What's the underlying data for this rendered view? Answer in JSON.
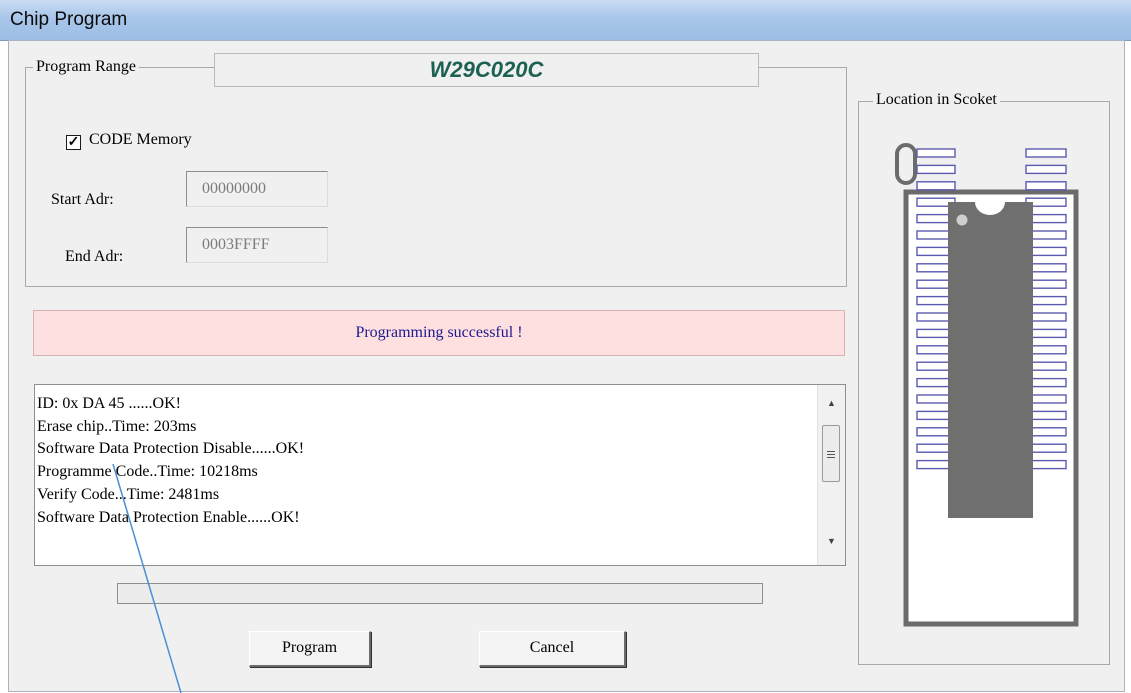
{
  "window": {
    "title": "Chip Program"
  },
  "program_range": {
    "label": "Program Range",
    "chip_name": "W29C020C",
    "code_memory": {
      "label": "CODE Memory",
      "checked": true,
      "check_mark": "✓"
    },
    "start_addr": {
      "label": "Start Adr:",
      "value": "00000000"
    },
    "end_addr": {
      "label": "End Adr:",
      "value": "0003FFFF"
    }
  },
  "status": {
    "text": "Programming successful !"
  },
  "log": {
    "lines": [
      "ID: 0x DA 45 ......OK!",
      "Erase chip..Time: 203ms",
      "Software Data Protection Disable......OK!",
      "Programme Code..Time: 10218ms",
      "Verify Code...Time: 2481ms",
      "Software Data Protection Enable......OK!"
    ]
  },
  "progress": {
    "fraction": 0
  },
  "buttons": {
    "program": "Program",
    "cancel": "Cancel"
  },
  "socket": {
    "label": "Location in Scoket",
    "icon": "dip-40-socket-icon"
  },
  "colors": {
    "chip_name": "#1d6152",
    "status_bg": "#ffe0e0",
    "status_text": "#1e1a8f",
    "annotation_line": "#4a8fd6"
  }
}
